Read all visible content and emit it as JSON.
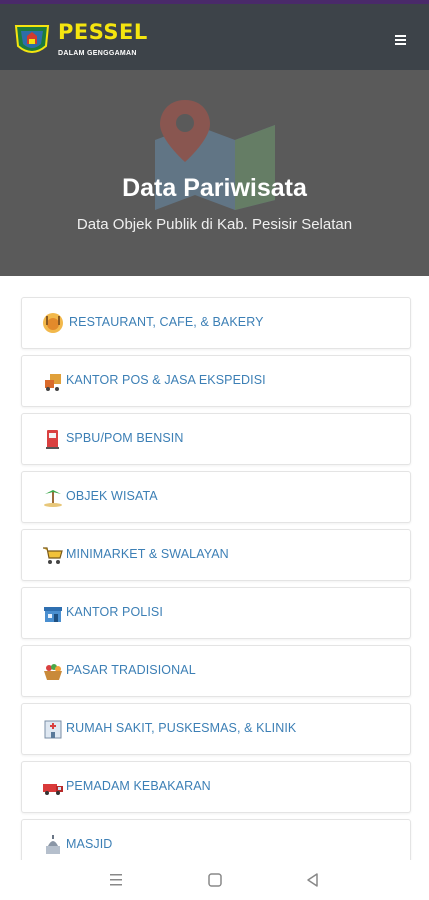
{
  "app": {
    "logo_title": "PESSEL",
    "logo_subtitle": "DALAM GENGGAMAN",
    "menu_icon": "hamburger-icon"
  },
  "hero": {
    "title": "Data Pariwisata",
    "subtitle": "Data Objek Publik di Kab. Pesisir Selatan"
  },
  "categories": [
    {
      "label": "RESTAURANT, CAFE, & BAKERY",
      "icon": "restaurant-icon"
    },
    {
      "label": "KANTOR POS & JASA EKSPEDISI",
      "icon": "delivery-icon"
    },
    {
      "label": "SPBU/POM BENSIN",
      "icon": "fuel-pump-icon"
    },
    {
      "label": "OBJEK WISATA",
      "icon": "island-icon"
    },
    {
      "label": "MINIMARKET & SWALAYAN",
      "icon": "cart-icon"
    },
    {
      "label": "KANTOR POLISI",
      "icon": "police-station-icon"
    },
    {
      "label": "PASAR TRADISIONAL",
      "icon": "basket-icon"
    },
    {
      "label": "RUMAH SAKIT, PUSKESMAS, & KLINIK",
      "icon": "hospital-icon"
    },
    {
      "label": "PEMADAM KEBAKARAN",
      "icon": "fire-truck-icon"
    },
    {
      "label": "MASJID",
      "icon": "mosque-icon"
    }
  ],
  "colors": {
    "appbar": "#3d4349",
    "logo_text": "#f5e50f",
    "item_text": "#3c7fb5"
  }
}
